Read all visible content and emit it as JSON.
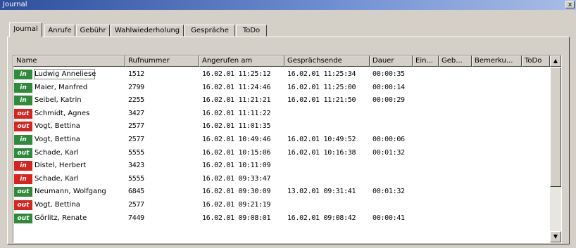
{
  "window": {
    "title": "Journal",
    "close_label": "x"
  },
  "tabs": [
    {
      "label": "Journal"
    },
    {
      "label": "Anrufe"
    },
    {
      "label": "Gebühr"
    },
    {
      "label": "Wahlwiederholung"
    },
    {
      "label": "Gespräche"
    },
    {
      "label": "ToDo"
    }
  ],
  "columns": [
    {
      "label": "Name"
    },
    {
      "label": "Rufnummer"
    },
    {
      "label": "Angerufen am"
    },
    {
      "label": "Gesprächsende"
    },
    {
      "label": "Dauer"
    },
    {
      "label": "Ein..."
    },
    {
      "label": "Geb..."
    },
    {
      "label": "Bemerku..."
    },
    {
      "label": "ToDo"
    }
  ],
  "rows": [
    {
      "dir": "in",
      "name": "Ludwig Anneliese",
      "number": "1512",
      "called": "16.02.01 11:25:12",
      "end": "16.02.01 11:25:34",
      "duration": "00:00:35"
    },
    {
      "dir": "in",
      "name": "Maier, Manfred",
      "number": "2799",
      "called": "16.02.01 11:24:46",
      "end": "16.02.01 11:25:00",
      "duration": "00:00:14"
    },
    {
      "dir": "in",
      "name": "Seibel, Katrin",
      "number": "2255",
      "called": "16.02.01 11:21:21",
      "end": "16.02.01 11:21:50",
      "duration": "00:00:29"
    },
    {
      "dir": "out",
      "name": "Schmidt, Agnes",
      "number": "3427",
      "called": "16.02.01 11:11:22",
      "end": "",
      "duration": ""
    },
    {
      "dir": "out",
      "name": "Vogt, Bettina",
      "number": "2577",
      "called": "16.02.01 11:01:35",
      "end": "",
      "duration": ""
    },
    {
      "dir": "in",
      "name": "Vogt, Bettina",
      "number": "2577",
      "called": "16.02.01 10:49:46",
      "end": "16.02.01 10:49:52",
      "duration": "00:00:06"
    },
    {
      "dir": "out-green",
      "name": "Schade, Karl",
      "number": "5555",
      "called": "16.02.01 10:15:06",
      "end": "16.02.01 10:16:38",
      "duration": "00:01:32"
    },
    {
      "dir": "in-red",
      "name": "Distel, Herbert",
      "number": "3423",
      "called": "16.02.01 10:11:09",
      "end": "",
      "duration": ""
    },
    {
      "dir": "in-red",
      "name": "Schade, Karl",
      "number": "5555",
      "called": "16.02.01 09:33:47",
      "end": "",
      "duration": ""
    },
    {
      "dir": "out-green",
      "name": "Neumann, Wolfgang",
      "number": "6845",
      "called": "16.02.01 09:30:09",
      "end": "13.02.01 09:31:41",
      "duration": "00:01:32"
    },
    {
      "dir": "out",
      "name": "Vogt, Bettina",
      "number": "2577",
      "called": "16.02.01 09:21:19",
      "end": "",
      "duration": ""
    },
    {
      "dir": "out-green",
      "name": "Görlitz, Renate",
      "number": "7449",
      "called": "16.02.01 09:08:01",
      "end": "16.02.01 09:08:42",
      "duration": "00:00:41"
    }
  ],
  "badge_labels": {
    "in": "in",
    "out": "out"
  },
  "colors": {
    "in_green": "#2f8a3a",
    "out_red": "#d8241f",
    "titlebar": "#2e4f9c"
  }
}
